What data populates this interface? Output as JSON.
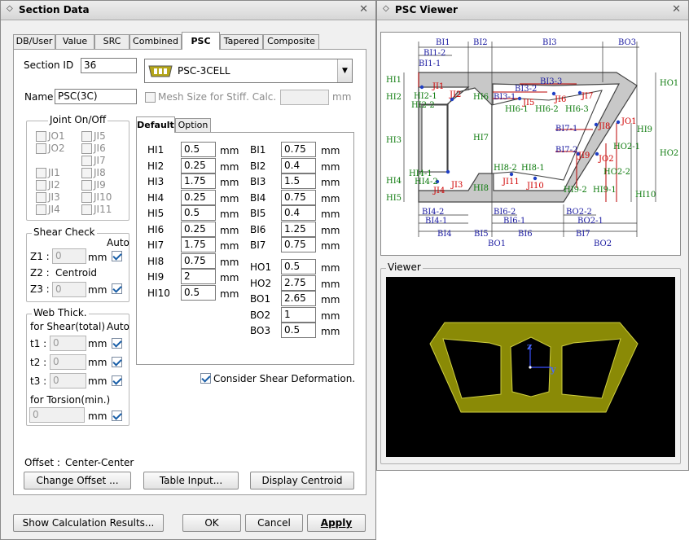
{
  "section_window": {
    "title": "Section Data",
    "tabs": [
      "DB/User",
      "Value",
      "SRC",
      "Combined",
      "PSC",
      "Tapered",
      "Composite"
    ],
    "section_id_label": "Section ID",
    "section_id": "36",
    "type_select": "PSC-3CELL",
    "name_label": "Name",
    "name_value": "PSC(3C)",
    "mesh_label": "Mesh Size for Stiff. Calc.",
    "mesh_unit": "mm",
    "joint_title": "Joint On/Off",
    "joints_left": [
      "JO1",
      "JO2",
      "",
      "JI1",
      "JI2",
      "JI3",
      "JI4"
    ],
    "joints_right": [
      "JI5",
      "JI6",
      "JI7",
      "JI8",
      "JI9",
      "JI10",
      "JI11"
    ],
    "shear_title": "Shear Check",
    "auto": "Auto",
    "z1_label": "Z1 :",
    "z1_value": "0",
    "z2_label": "Z2 :",
    "z2_value": "Centroid",
    "z3_label": "Z3 :",
    "z3_value": "0",
    "mm": "mm",
    "web_title": "Web Thick.",
    "for_shear": "for Shear(total)",
    "t1_label": "t1 :",
    "t2_label": "t2 :",
    "t3_label": "t3 :",
    "t_value": "0",
    "for_torsion": "for Torsion(min.)",
    "torsion_value": "0",
    "offset_label": "Offset :",
    "offset_value": "Center-Center",
    "subtabs": [
      "Default",
      "Option"
    ],
    "left_params": [
      {
        "name": "HI1",
        "value": "0.5"
      },
      {
        "name": "HI2",
        "value": "0.25"
      },
      {
        "name": "HI3",
        "value": "1.75"
      },
      {
        "name": "HI4",
        "value": "0.25"
      },
      {
        "name": "HI5",
        "value": "0.5"
      },
      {
        "name": "HI6",
        "value": "0.25"
      },
      {
        "name": "HI7",
        "value": "1.75"
      },
      {
        "name": "HI8",
        "value": "0.75"
      },
      {
        "name": "HI9",
        "value": "2"
      },
      {
        "name": "HI10",
        "value": "0.5"
      }
    ],
    "right_params": [
      {
        "name": "BI1",
        "value": "0.75"
      },
      {
        "name": "BI2",
        "value": "0.4"
      },
      {
        "name": "BI3",
        "value": "1.5"
      },
      {
        "name": "BI4",
        "value": "0.75"
      },
      {
        "name": "BI5",
        "value": "0.4"
      },
      {
        "name": "BI6",
        "value": "1.25"
      },
      {
        "name": "BI7",
        "value": "0.75"
      }
    ],
    "right_params2": [
      {
        "name": "HO1",
        "value": "0.5"
      },
      {
        "name": "HO2",
        "value": "2.75"
      },
      {
        "name": "BO1",
        "value": "2.65"
      },
      {
        "name": "BO2",
        "value": "1"
      },
      {
        "name": "BO3",
        "value": "0.5"
      }
    ],
    "consider_shear": "Consider Shear Deformation.",
    "btn_change_offset": "Change Offset ...",
    "btn_table_input": "Table Input...",
    "btn_display_centroid": "Display Centroid",
    "btn_show_results": "Show Calculation Results...",
    "btn_ok": "OK",
    "btn_cancel": "Cancel",
    "btn_apply": "Apply"
  },
  "psc_window": {
    "title": "PSC Viewer",
    "viewer_label": "Viewer",
    "dim_labels_blue": [
      "BI1",
      "BI1-2",
      "BI1-1",
      "BI2",
      "BI3",
      "BO3",
      "BI3-3",
      "BI3-2",
      "BI3-1",
      "BI7-1",
      "BI7-2",
      "BI4-2",
      "BI4-1",
      "BI6-2",
      "BI6-1",
      "BO2-2",
      "BO2-1",
      "BI4",
      "BI5",
      "BI6",
      "BI7",
      "BO1",
      "BO2"
    ],
    "dim_labels_green": [
      "HI1",
      "HI2",
      "HI2-1",
      "HI2-2",
      "HI6",
      "HI6-1",
      "HI6-2",
      "HI6-3",
      "HI3",
      "HI7",
      "HI4",
      "HI4-1",
      "HI4-2",
      "HI5",
      "HI8",
      "HI8-2",
      "HI8-1",
      "HO1",
      "HO2",
      "HO2-1",
      "HO2-2",
      "HI9",
      "HI10",
      "HI9-1",
      "HI9-2"
    ],
    "joint_labels_red": [
      "JI1",
      "JI2",
      "JI3",
      "JI4",
      "JI5",
      "JI6",
      "JI7",
      "JI8",
      "JI9",
      "JI10",
      "JI11",
      "JO1",
      "JO2"
    ],
    "axis_z": "z",
    "axis_y": "y"
  }
}
